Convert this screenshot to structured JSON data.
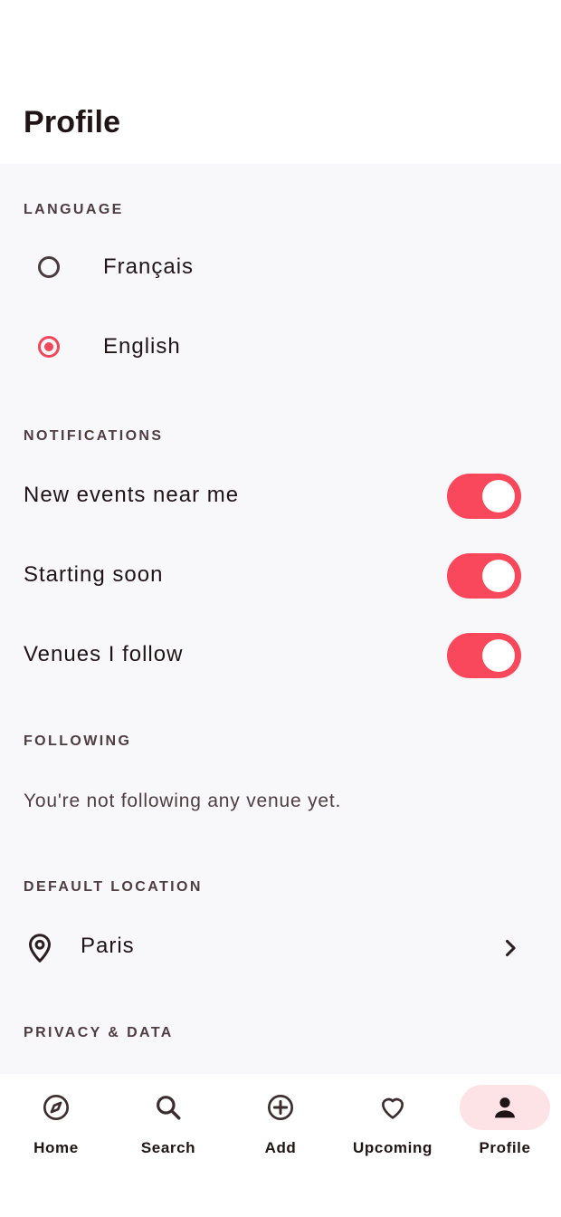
{
  "header": {
    "title": "Profile"
  },
  "language": {
    "title": "LANGUAGE",
    "options": [
      {
        "label": "Français",
        "selected": false
      },
      {
        "label": "English",
        "selected": true
      }
    ]
  },
  "notifications": {
    "title": "NOTIFICATIONS",
    "items": [
      {
        "label": "New events near me",
        "enabled": true
      },
      {
        "label": "Starting soon",
        "enabled": true
      },
      {
        "label": "Venues I follow",
        "enabled": true
      }
    ]
  },
  "following": {
    "title": "FOLLOWING",
    "empty_text": "You're not following any venue yet."
  },
  "default_location": {
    "title": "DEFAULT LOCATION",
    "value": "Paris",
    "icon": "location-pin-icon"
  },
  "privacy": {
    "title": "PRIVACY & DATA"
  },
  "nav": {
    "items": [
      {
        "label": "Home",
        "icon": "compass-icon",
        "active": false
      },
      {
        "label": "Search",
        "icon": "search-icon",
        "active": false
      },
      {
        "label": "Add",
        "icon": "add-circle-icon",
        "active": false
      },
      {
        "label": "Upcoming",
        "icon": "heart-icon",
        "active": false
      },
      {
        "label": "Profile",
        "icon": "person-icon",
        "active": true
      }
    ]
  },
  "colors": {
    "accent": "#f9485b",
    "active_pill": "#fde3e6",
    "content_bg": "#f8f8fb",
    "section_title": "#4e3d40"
  }
}
